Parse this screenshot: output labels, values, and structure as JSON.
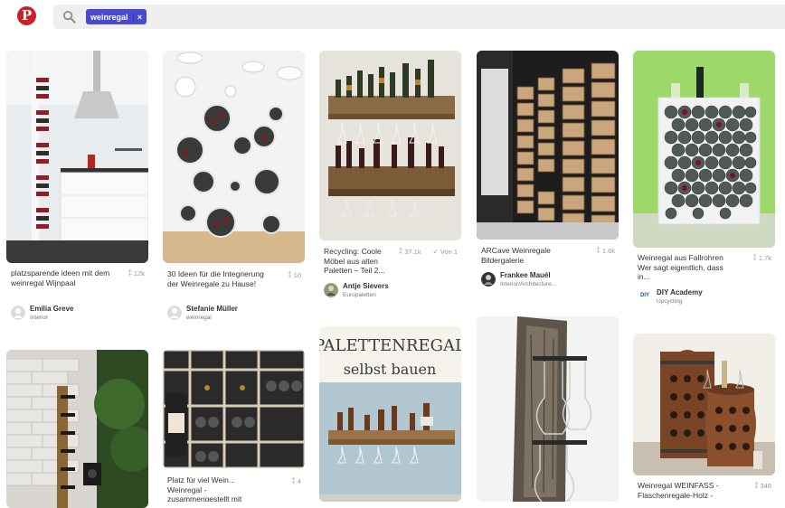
{
  "header": {
    "logo_letter": "P",
    "search_chip": "weinregal",
    "chip_close": "×"
  },
  "pins": [
    {
      "id": "p1",
      "title": "platzsparende ideen mit dem weinregal Wijnpaal",
      "saves": "12k",
      "user": "Emilia Greve",
      "board": "Interior"
    },
    {
      "id": "p2",
      "title": "30 Ideen für die Integrierung der Weinregale zu Hause!",
      "saves": "10",
      "user": "Stefanie Müller",
      "board": "weinregal"
    },
    {
      "id": "p3",
      "title": "Recycling: Coole Möbel aus alten Paletten – Teil 2...",
      "saves": "37.1k",
      "extra": "Von 1",
      "user": "Antje Sievers",
      "board": "Europaletten"
    },
    {
      "id": "p4",
      "title": "ARCave Weinregale Bildergalerie",
      "saves": "1.6k",
      "user": "Frankee Mauél",
      "board": "Interior/Architecture..."
    },
    {
      "id": "p5",
      "title": "Weinregal aus Fallrohren Wer sagt eigentlich, dass in...",
      "saves": "1.7k",
      "user": "DIY Academy",
      "board": "Upcycling",
      "avatar_text": "DIY"
    },
    {
      "id": "p6",
      "title": "",
      "saves": ""
    },
    {
      "id": "p7",
      "title": "Platz für viel Wein... Weinregal - zusammengestellt mit",
      "saves": "4"
    },
    {
      "id": "p8",
      "title": "",
      "image_text_1": "PALETTENREGAL",
      "image_text_2": "selbst bauen"
    },
    {
      "id": "p9",
      "title": ""
    },
    {
      "id": "p10",
      "title": "Weinregal WEINFASS - Flaschenregale-Holz -",
      "saves": "348"
    }
  ],
  "colors": {
    "brand": "#cb2027",
    "chip": "#4a4ad0",
    "search_bg": "#efefef"
  },
  "icons": {
    "logo": "pinterest-logo-icon",
    "search": "search-icon",
    "save": "pin-icon"
  }
}
